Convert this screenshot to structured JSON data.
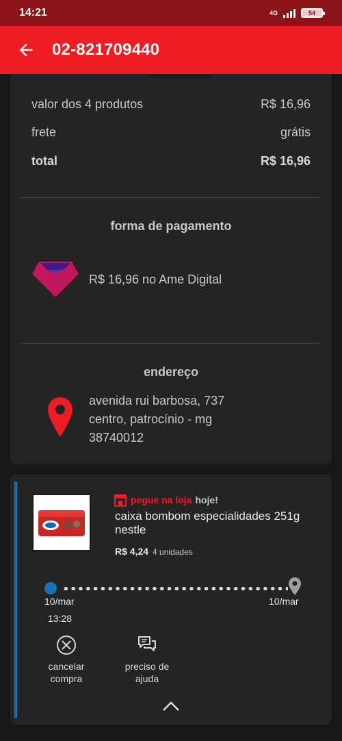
{
  "status_bar": {
    "time": "14:21",
    "network": "4G",
    "battery": "54"
  },
  "app_bar": {
    "title": "02-821709440",
    "back_icon": "arrow-back-icon"
  },
  "summary": {
    "products_label": "valor dos 4 produtos",
    "products_value": "R$ 16,96",
    "shipping_label": "frete",
    "shipping_value": "grátis",
    "total_label": "total",
    "total_value": "R$ 16,96"
  },
  "payment": {
    "title": "forma de pagamento",
    "text": "R$ 16,96 no Ame Digital",
    "icon": "ame-digital-logo-icon"
  },
  "address": {
    "title": "endereço",
    "line1": "avenida rui barbosa, 737",
    "line2": "centro, patrocínio - mg",
    "line3": "38740012",
    "icon": "location-pin-icon"
  },
  "item": {
    "pickup_label": "pegue na loja",
    "pickup_when": "hoje!",
    "name": "caixa bombom especialidades 251g nestle",
    "price": "R$ 4,24",
    "quantity": "4 unidades",
    "tracking": {
      "start_date": "10/mar",
      "start_time": "13:28",
      "end_date": "10/mar"
    },
    "actions": {
      "cancel_label_1": "cancelar",
      "cancel_label_2": "compra",
      "help_label_1": "preciso de",
      "help_label_2": "ajuda"
    }
  },
  "colors": {
    "brand_red": "#ee1d23",
    "status_bar": "#8c1318",
    "accent_blue": "#1671b6",
    "background": "#181818",
    "card": "#242424"
  }
}
